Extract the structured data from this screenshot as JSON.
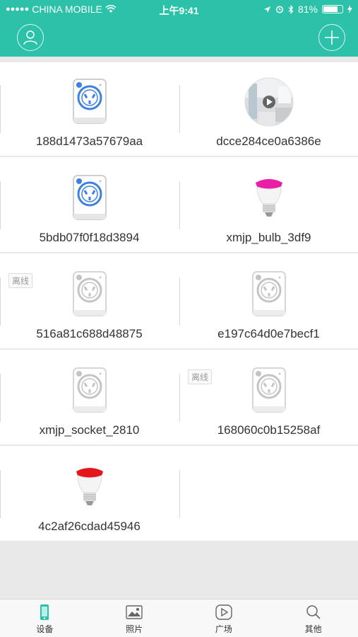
{
  "status_bar": {
    "carrier": "CHINA MOBILE",
    "time": "上午9:41",
    "battery": "81%"
  },
  "colors": {
    "accent": "#2bc2a9",
    "bulb_magenta": "#e91fa8",
    "bulb_red": "#e4161c",
    "online_blue": "#3f7fde",
    "offline_gray": "#c4c4c4"
  },
  "devices": [
    {
      "name": "188d1473a57679aa",
      "icon": "socket-icon",
      "online": true
    },
    {
      "name": "dcce284ce0a6386e",
      "icon": "camera-thumbnail",
      "online": true
    },
    {
      "name": "5bdb07f0f18d3894",
      "icon": "socket-icon",
      "online": true
    },
    {
      "name": "xmjp_bulb_3df9",
      "icon": "bulb-icon",
      "online": true
    },
    {
      "name": "516a81c688d48875",
      "icon": "socket-icon",
      "online": false,
      "badge": "离线"
    },
    {
      "name": "e197c64d0e7becf1",
      "icon": "socket-icon",
      "online": false
    },
    {
      "name": "xmjp_socket_2810",
      "icon": "socket-icon",
      "online": false
    },
    {
      "name": "168060c0b15258af",
      "icon": "socket-icon",
      "online": false,
      "badge": "离线"
    },
    {
      "name": "4c2af26cdad45946",
      "icon": "bulb-icon",
      "online": true
    }
  ],
  "tabs": [
    {
      "label": "设备",
      "icon": "device-icon",
      "active": true
    },
    {
      "label": "照片",
      "icon": "photo-icon",
      "active": false
    },
    {
      "label": "广场",
      "icon": "play-icon",
      "active": false
    },
    {
      "label": "其他",
      "icon": "search-icon",
      "active": false
    }
  ]
}
